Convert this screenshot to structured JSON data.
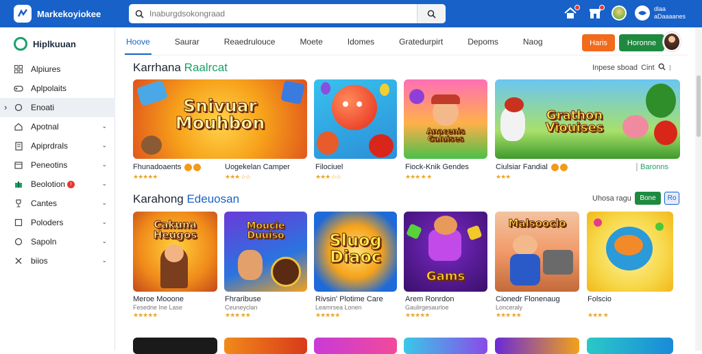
{
  "app": {
    "name": "Markekoyiokee"
  },
  "search": {
    "placeholder": "Inaburgdsokongraad"
  },
  "account": {
    "line1": "dlaa",
    "line2": "aDaaaanes"
  },
  "sidebar": {
    "title": "Hiplkuuan",
    "items": [
      {
        "label": "Alpiures",
        "icon": "grid-icon",
        "chevron": false
      },
      {
        "label": "Aplpolaits",
        "icon": "gamepad-icon",
        "chevron": false
      },
      {
        "label": "Enoati",
        "icon": "circle-icon",
        "chevron": false,
        "active": true
      },
      {
        "label": "Apotnal",
        "icon": "home-icon",
        "chevron": true
      },
      {
        "label": "Apiprdrals",
        "icon": "document-icon",
        "chevron": true
      },
      {
        "label": "Peneotins",
        "icon": "box-icon",
        "chevron": true
      },
      {
        "label": "Beolotion",
        "icon": "gift-icon",
        "chevron": true,
        "badge": true
      },
      {
        "label": "Cantes",
        "icon": "trophy-icon",
        "chevron": true
      },
      {
        "label": "Poloders",
        "icon": "folder-icon",
        "chevron": true
      },
      {
        "label": "Sapoln",
        "icon": "ring-icon",
        "chevron": true
      },
      {
        "label": "biios",
        "icon": "tools-icon",
        "chevron": true
      }
    ]
  },
  "tabs": [
    "Hoove",
    "Saurar",
    "Reaedrulouce",
    "Moete",
    "Idomes",
    "Gratedurpirt",
    "Depoms",
    "Naog"
  ],
  "header_buttons": {
    "orange": "Haris",
    "green": "Horonne"
  },
  "section1": {
    "title_a": "Karrhana",
    "title_b": "Raalrcat",
    "tools_label": "Inpese sboad",
    "tools_extra": "Cint",
    "link": "Baronns",
    "cards": [
      {
        "title": "Fhunadoaents",
        "sub": "",
        "stars": "★★★★★",
        "art": "Snivuar Mouhbon",
        "pills": true
      },
      {
        "title": "Uogekelan Camper",
        "sub": "",
        "stars": "★★★ ☆☆",
        "art": "",
        "pills": false
      },
      {
        "title": "Filociuel",
        "sub": "",
        "stars": "★★★ ☆☆",
        "art": "",
        "pills": false
      },
      {
        "title": "Fiock-Knik Gendes",
        "sub": "",
        "stars": "★★★ ★ ★",
        "art": "Anacenis Galuises",
        "pills": false
      },
      {
        "title": "Ciulsiar Fandial",
        "sub": "",
        "stars": "★★★",
        "art": "Grathon Viouises",
        "pills": true
      }
    ]
  },
  "section2": {
    "title_a": "Karahong",
    "title_b": "Edeuosan",
    "tools_label": "Uhosa ragu",
    "btn_green": "Bone",
    "btn_blue": "Ro",
    "cards": [
      {
        "title": "Meroe Mooone",
        "sub": "Fesedne Ine Lase",
        "stars": "★★★★★",
        "art": "Cakuna Heugos"
      },
      {
        "title": "Fhraribuse",
        "sub": "Ceuneyclan",
        "stars": "★★★ ★★",
        "art": "Moucie Duuiso"
      },
      {
        "title": "Rivsin' Plotime Care",
        "sub": "Leamrsea Lonen",
        "stars": "★★★★★",
        "art": "Sluog Diaoc"
      },
      {
        "title": "Arem Ronrdon",
        "sub": "Gaulirgesaurloe",
        "stars": "★★★★★",
        "art": "Gams"
      },
      {
        "title": "Cionedr Flonenaug",
        "sub": "Lonceraly",
        "stars": "★★★ ★★",
        "art": "Malsooclo"
      },
      {
        "title": "Folscio",
        "sub": "",
        "stars": "★★★ ★",
        "art": ""
      }
    ]
  },
  "colors": {
    "topbar": "#1761c9",
    "accent_green": "#1aa16a",
    "button_orange": "#f26a1b",
    "button_green": "#1f8a3f"
  }
}
